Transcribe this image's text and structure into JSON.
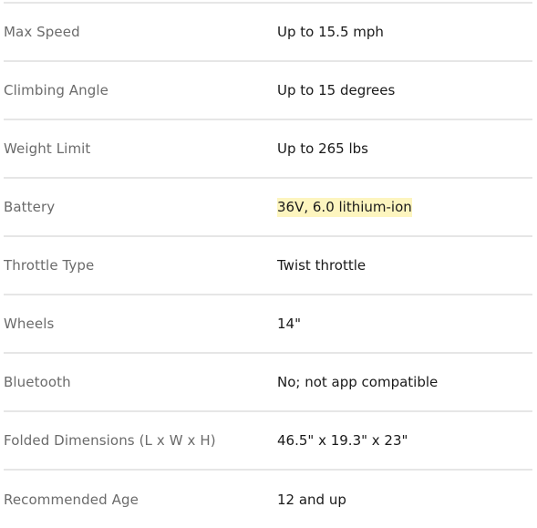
{
  "specs": {
    "rows": [
      {
        "label": "Max Speed",
        "value": "Up to 15.5 mph",
        "highlighted": false
      },
      {
        "label": "Climbing Angle",
        "value": "Up to 15 degrees",
        "highlighted": false
      },
      {
        "label": "Weight Limit",
        "value": "Up to 265 lbs",
        "highlighted": false
      },
      {
        "label": "Battery",
        "value": "36V, 6.0 lithium-ion",
        "highlighted": true
      },
      {
        "label": "Throttle Type",
        "value": "Twist throttle",
        "highlighted": false
      },
      {
        "label": "Wheels",
        "value": "14\"",
        "highlighted": false
      },
      {
        "label": "Bluetooth",
        "value": "No; not app compatible",
        "highlighted": false
      },
      {
        "label": "Folded Dimensions (L x W x H)",
        "value": "46.5\" x 19.3\" x 23\"",
        "highlighted": false
      },
      {
        "label": "Recommended Age",
        "value": "12 and up",
        "highlighted": false
      }
    ],
    "highlight_color": "#fdf5bf",
    "label_color": "#6b6b6b",
    "value_color": "#1a1a1a",
    "border_color": "#e6e6e6"
  }
}
